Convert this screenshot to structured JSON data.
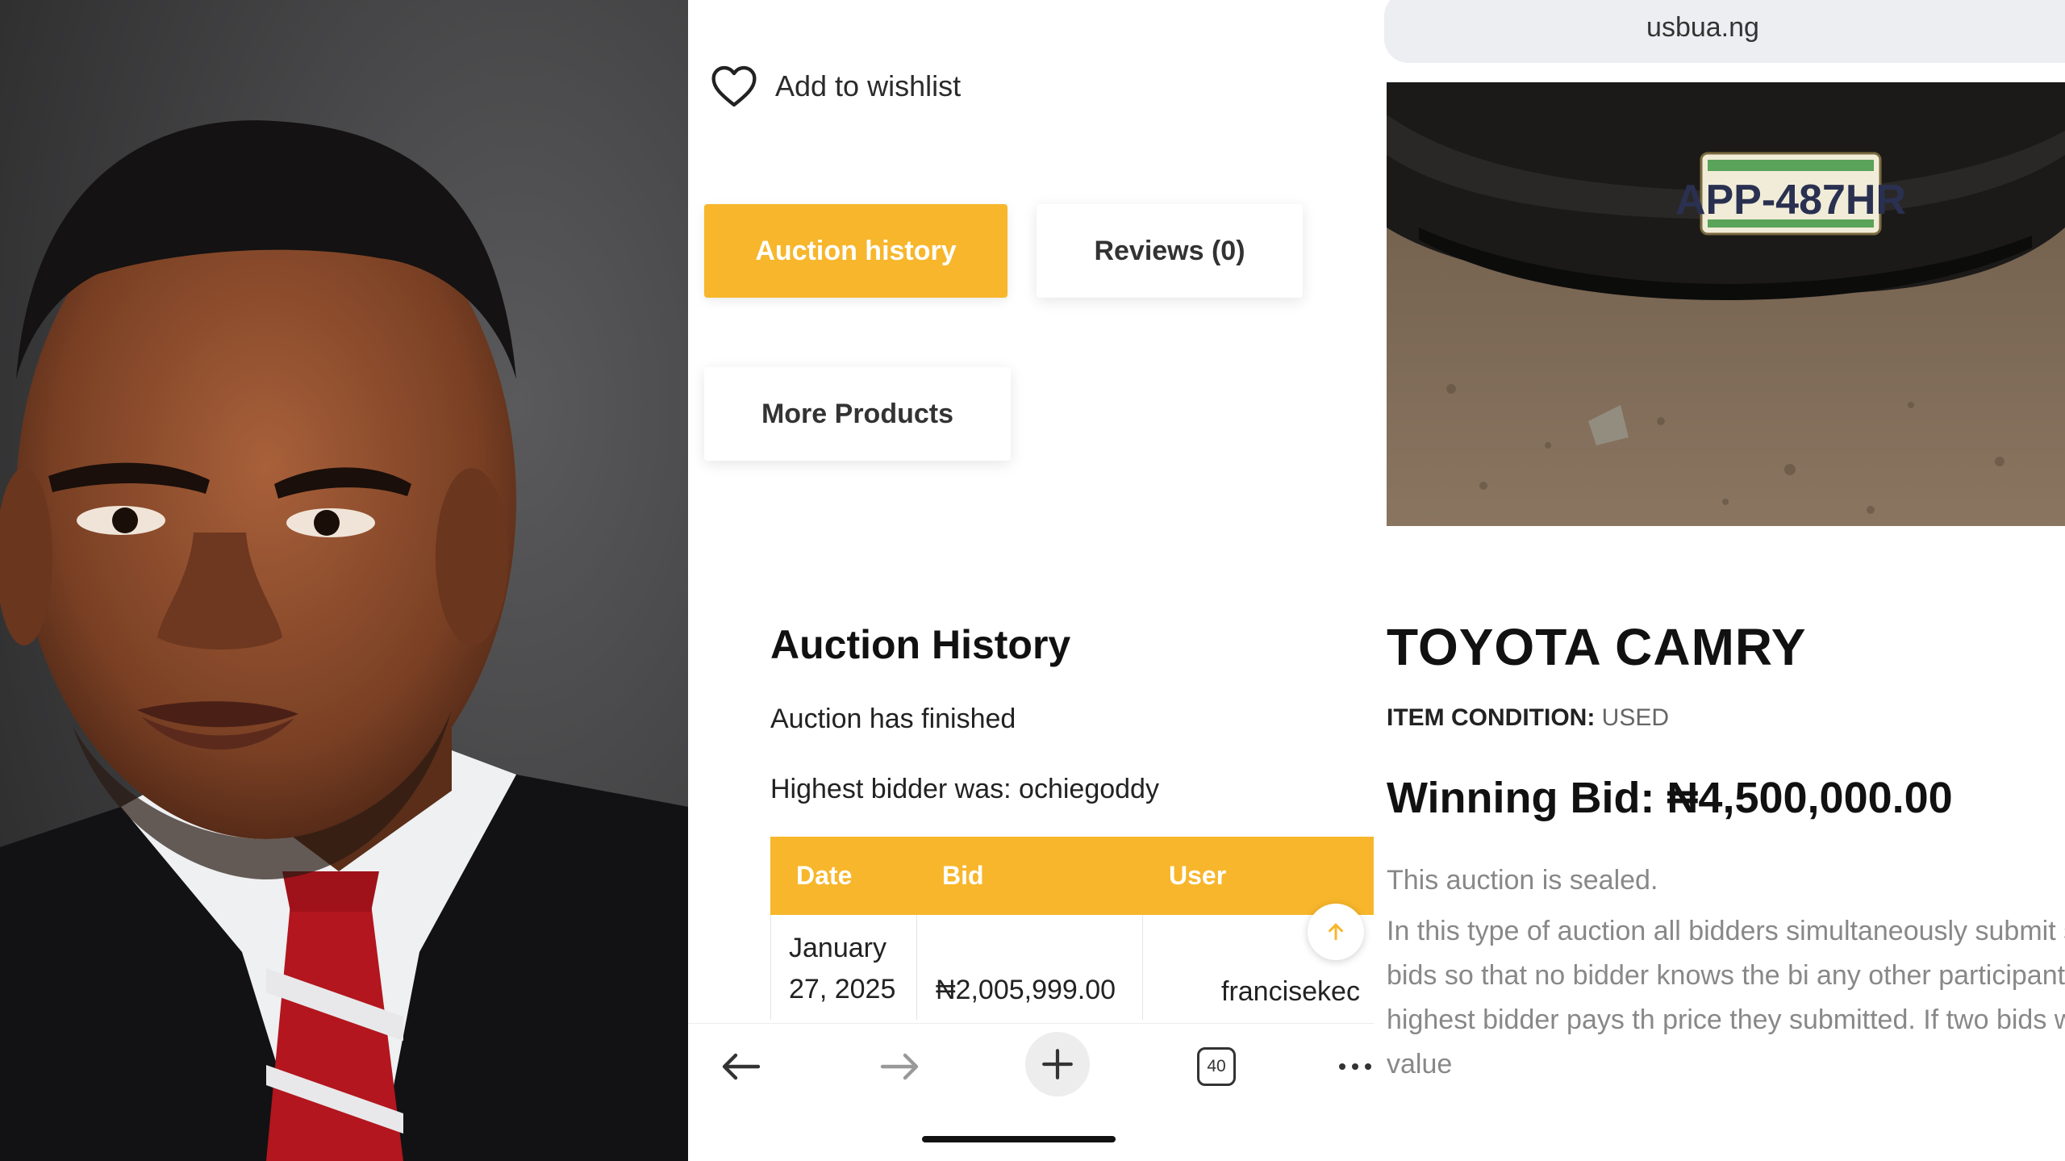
{
  "product_page": {
    "wishlist_label": "Add to wishlist",
    "tabs": [
      {
        "label": "Auction history",
        "active": true
      },
      {
        "label": "Reviews (0)",
        "active": false
      },
      {
        "label": "More Products",
        "active": false
      }
    ],
    "auction_history": {
      "title": "Auction History",
      "status": "Auction has finished",
      "highest_bidder": "Highest bidder was: ochiegoddy",
      "columns": [
        "Date",
        "Bid",
        "User"
      ],
      "rows": [
        {
          "date_line1": "January",
          "date_line2": "27, 2025",
          "bid": "₦2,005,999.00",
          "user": "francisekec"
        }
      ]
    },
    "scroll_top_icon": "arrow-up-icon"
  },
  "browser_nav": {
    "icons": [
      "back-arrow-icon",
      "forward-arrow-icon",
      "plus-icon",
      "tabs-icon",
      "more-icon"
    ],
    "tab_count": "40"
  },
  "listing": {
    "url": "usbua.ng",
    "plate_text": "APP-487HR",
    "title": "TOYOTA CAMRY",
    "condition_label": "ITEM CONDITION:",
    "condition_value": "USED",
    "winning_bid": "Winning Bid: ₦4,500,000.00",
    "sealed_note": "This auction is sealed.",
    "description": "In this type of auction all bidders simultaneously submit sealed bids so that no bidder knows the bi any other participant. The highest bidder pays th price they submitted. If two bids with same value"
  },
  "colors": {
    "accent": "#f7b62b",
    "portrait_bg": "#3f3f40",
    "text_dark": "#111111",
    "text_muted": "#888888"
  }
}
